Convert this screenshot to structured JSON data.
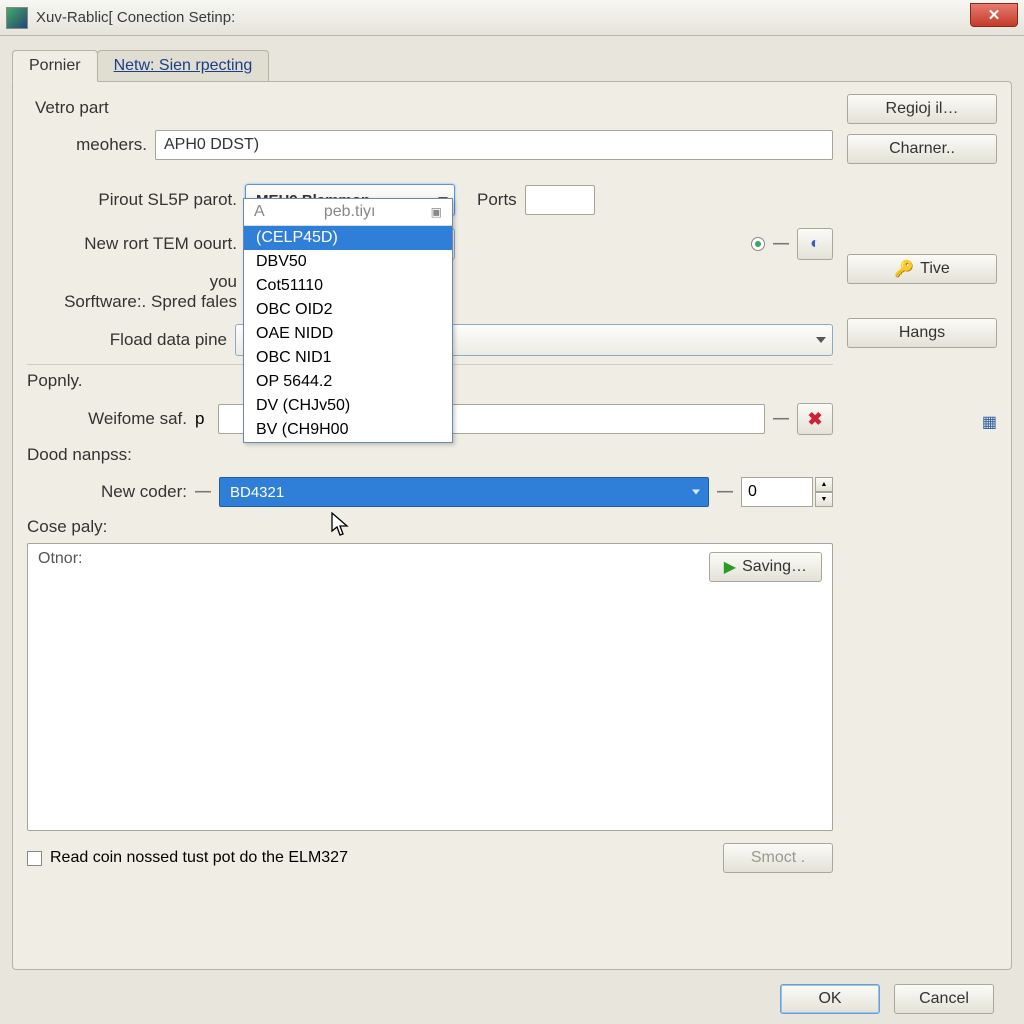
{
  "window": {
    "title": "Xuv-Rablic[ Conection Setinp:"
  },
  "tabs": {
    "active": "Pornier",
    "inactive": "Netw: Sien rpecting"
  },
  "groups": {
    "vetro": "Vetro part",
    "popnly": "Popnly.",
    "dood": "Dood nanpss:",
    "cose": "Cose paly:"
  },
  "labels": {
    "meohers": "meohers.",
    "pirout": "Pirout SL5P parot.",
    "newport": "New rort TEM oourt.",
    "you": "you",
    "software": "Sorftware:. Spred fales",
    "fload": "Fload data pine",
    "ports": "Ports",
    "weifome": "Weifome saf.",
    "newcoder": "New coder:",
    "otnor": "Otnor:",
    "checkbox": "Read coin nossed tust pot do the ELM327"
  },
  "values": {
    "meohers_text": "APH0 DDST)",
    "pirout_combo": "MEH9 Blammon",
    "weifome_p": "p",
    "coder_value": "BD4321",
    "spin_value": "0"
  },
  "dropdown": {
    "header": "peb.tiyı",
    "options": [
      "(CELP45D)",
      "DBV50",
      "Cot51110",
      "OBC OID2",
      "OAE NIDD",
      "OBC NID1",
      "OP 5644.2",
      "DV (CHJv50)",
      "BV (CH9H00"
    ],
    "selected_index": 0
  },
  "buttons": {
    "regio": "Regioj il…",
    "charner": "Charner..",
    "tive": "Tive",
    "hangs": "Hangs",
    "saving": "Saving…",
    "smoct": "Smoct .",
    "ok": "OK",
    "cancel": "Cancel"
  }
}
